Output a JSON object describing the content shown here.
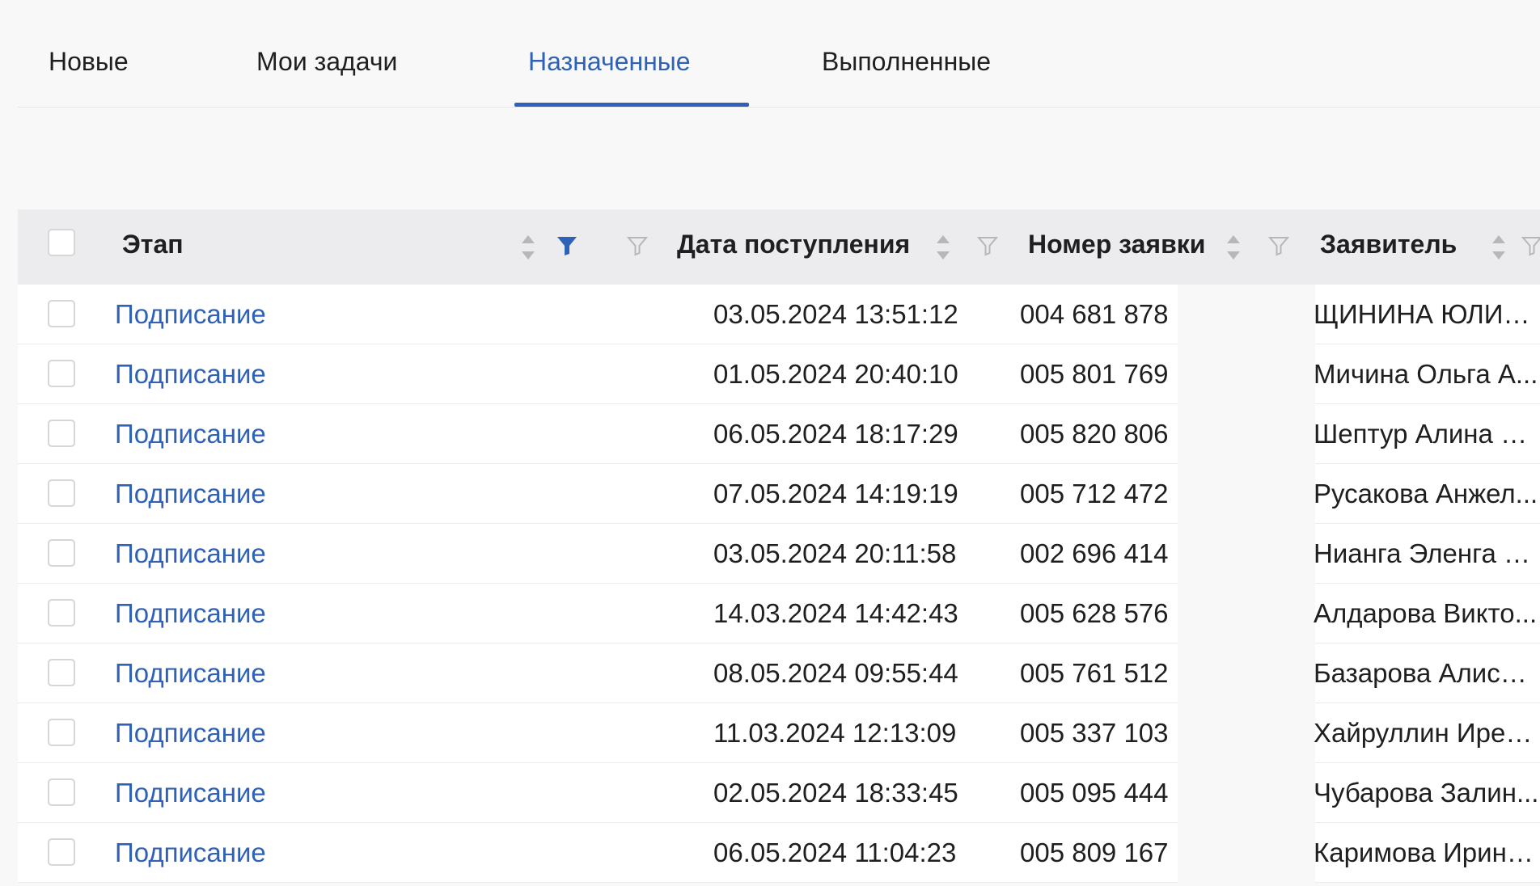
{
  "tabs": {
    "new": "Новые",
    "my_tasks": "Мои задачи",
    "assigned": "Назначенные",
    "completed": "Выполненные"
  },
  "active_tab": "assigned",
  "colors": {
    "accent": "#2f62b6",
    "header_bg": "#ececee",
    "page_bg": "#f8f8f9"
  },
  "table": {
    "columns": {
      "stage": "Этап",
      "received_date": "Дата поступления",
      "request_number": "Номер заявки",
      "applicant": "Заявитель"
    },
    "rows": [
      {
        "stage": "Подписание",
        "received_date": "03.05.2024 13:51:12",
        "request_number": "004 681 878",
        "applicant": "ЩИНИНА ЮЛИЯ..."
      },
      {
        "stage": "Подписание",
        "received_date": "01.05.2024 20:40:10",
        "request_number": "005 801 769",
        "applicant": "Мичина Ольга А..."
      },
      {
        "stage": "Подписание",
        "received_date": "06.05.2024 18:17:29",
        "request_number": "005 820 806",
        "applicant": "Шептур Алина И..."
      },
      {
        "stage": "Подписание",
        "received_date": "07.05.2024 14:19:19",
        "request_number": "005 712 472",
        "applicant": "Русакова Анжел..."
      },
      {
        "stage": "Подписание",
        "received_date": "03.05.2024 20:11:58",
        "request_number": "002 696 414",
        "applicant": "Нианга Эленга П..."
      },
      {
        "stage": "Подписание",
        "received_date": "14.03.2024 14:42:43",
        "request_number": "005 628 576",
        "applicant": "Алдарова Викто..."
      },
      {
        "stage": "Подписание",
        "received_date": "08.05.2024 09:55:44",
        "request_number": "005 761 512",
        "applicant": "Базарова Алиса ..."
      },
      {
        "stage": "Подписание",
        "received_date": "11.03.2024 12:13:09",
        "request_number": "005 337 103",
        "applicant": "Хайруллин Ирек ..."
      },
      {
        "stage": "Подписание",
        "received_date": "02.05.2024 18:33:45",
        "request_number": "005 095 444",
        "applicant": "Чубарова Залин..."
      },
      {
        "stage": "Подписание",
        "received_date": "06.05.2024 11:04:23",
        "request_number": "005 809 167",
        "applicant": "Каримова Ирина..."
      }
    ]
  }
}
